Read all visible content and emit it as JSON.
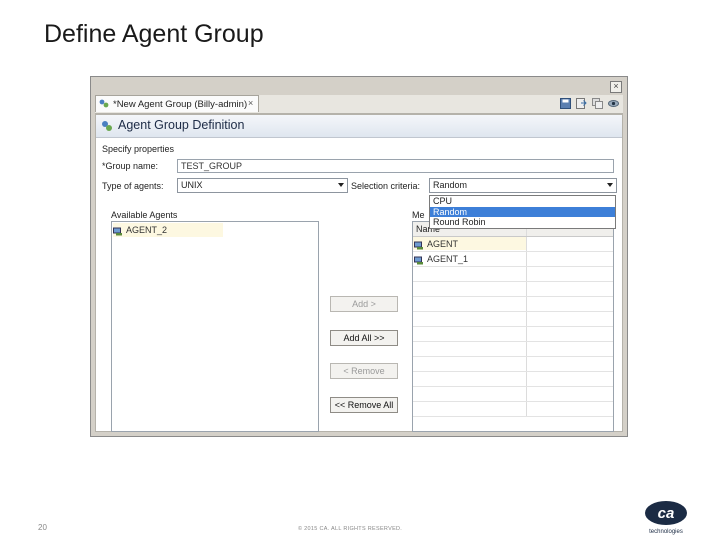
{
  "slide": {
    "title": "Define Agent Group",
    "page_number": "20",
    "copyright": "© 2015 CA. ALL RIGHTS RESERVED.",
    "logo_text": "ca",
    "logo_subtext": "technologies"
  },
  "window": {
    "close_glyph": "×",
    "tab_label": "*New Agent Group (Billy-admin)",
    "tab_close_glyph": "×",
    "toolbar_icons": [
      "save-icon",
      "save-as-icon",
      "copy-icon",
      "view-icon"
    ]
  },
  "editor": {
    "title": "Agent Group Definition",
    "section_label": "Specify properties",
    "group_name_label": "*Group name:",
    "group_name_value": "TEST_GROUP",
    "type_label": "Type of agents:",
    "type_value": "UNIX",
    "criteria_label": "Selection criteria:",
    "criteria_value": "Random",
    "criteria_options": [
      "CPU",
      "Random",
      "Round Robin"
    ],
    "criteria_selected": "Random",
    "available_label": "Available Agents",
    "available_agents": [
      "AGENT_2"
    ],
    "members_label": "Me",
    "members_column": "Name",
    "members": [
      "AGENT",
      "AGENT_1"
    ],
    "buttons": {
      "add": "Add >",
      "add_all": "Add All >>",
      "remove": "< Remove",
      "remove_all": "<< Remove All"
    }
  }
}
